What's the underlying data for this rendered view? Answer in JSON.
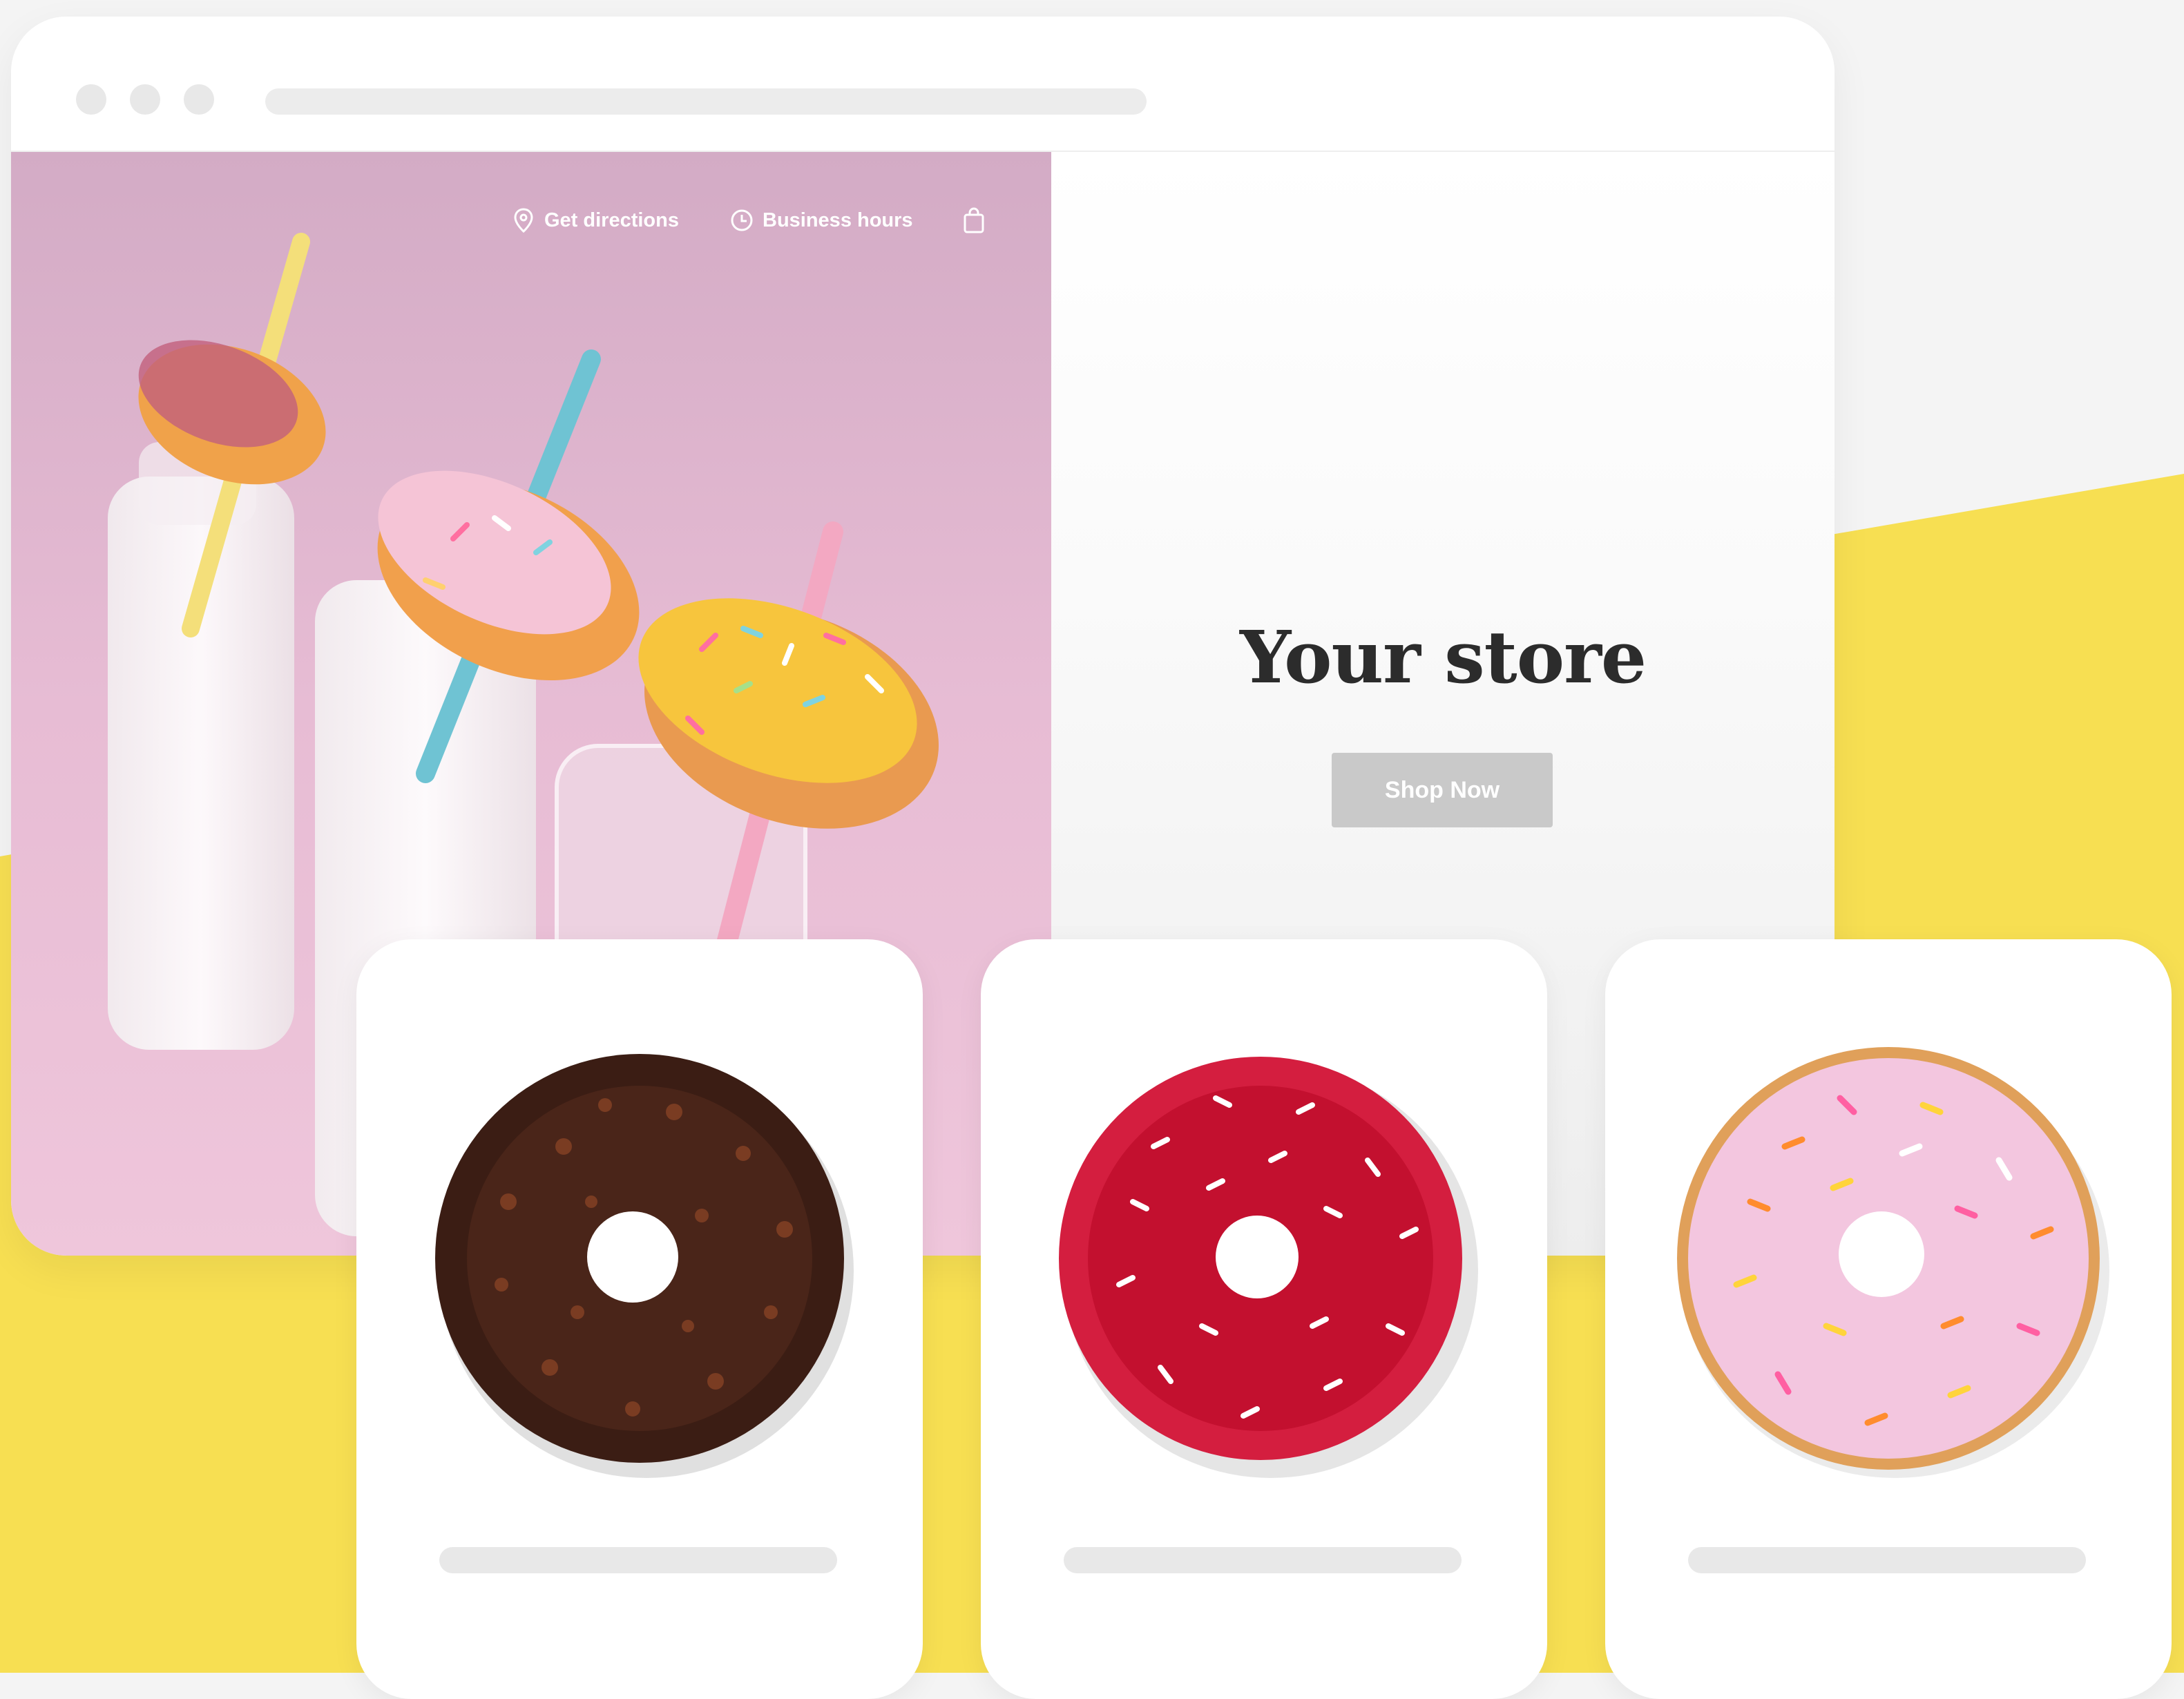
{
  "colors": {
    "yellow": "#f7df52",
    "pink": "#e9bfd3",
    "button_gray": "#c9c9c9",
    "title_dark": "#2c2c2c"
  },
  "nav": {
    "directions": {
      "label": "Get directions",
      "icon": "location-pin-icon"
    },
    "hours": {
      "label": "Business hours",
      "icon": "clock-icon"
    },
    "cart": {
      "icon": "shopping-bag-icon"
    }
  },
  "hero": {
    "title": "Your store",
    "cta": "Shop Now"
  },
  "products": [
    {
      "name": "chocolate-donut",
      "glaze": "#3b1d14"
    },
    {
      "name": "red-sprinkle-donut",
      "glaze": "#d41e3f"
    },
    {
      "name": "pink-sprinkle-donut",
      "glaze": "#f3c6df"
    }
  ]
}
